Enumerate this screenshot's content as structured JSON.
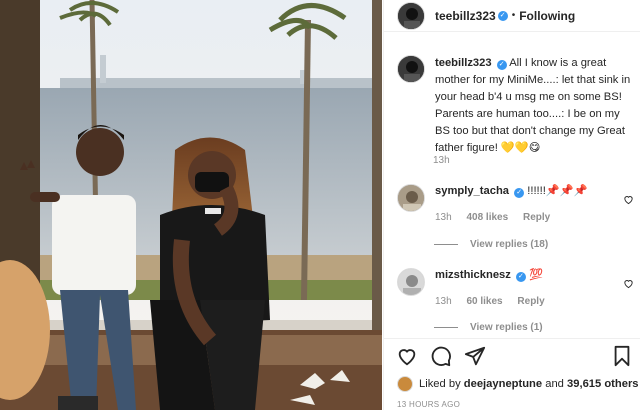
{
  "post": {
    "username": "teebillz323",
    "follow_status": "Following",
    "separator": "•",
    "verified_mark": "✓",
    "caption_username": "teebillz323",
    "caption_text": "All I know is a great mother for my MiniMe....: let that sink in your head b'4 u msg me on some BS! Parents are human too....: I be on my BS too but that don't change my Great father figure! 💛💛😋",
    "caption_time": "13h"
  },
  "comments": [
    {
      "username": "symply_tacha",
      "text": "!!!!!!📌📌📌",
      "time": "13h",
      "likes": "408 likes",
      "reply_label": "Reply",
      "view_replies": "View replies (18)",
      "avatar_color": "#9a8f7e"
    },
    {
      "username": "mizsthicknesz",
      "text": "💯",
      "time": "13h",
      "likes": "60 likes",
      "reply_label": "Reply",
      "view_replies": "View replies (1)",
      "avatar_color": "#c8c8c8"
    }
  ],
  "footer": {
    "liked_by_prefix": "Liked by",
    "liked_by_user": "deejayneptune",
    "liked_by_and": "and",
    "liked_by_count": "39,615 others",
    "timestamp": "13 HOURS AGO"
  },
  "icons": {
    "heart": "heart-icon",
    "comment": "comment-icon",
    "share": "share-icon",
    "bookmark": "bookmark-icon"
  },
  "colors": {
    "verified": "#3897f0",
    "text": "#262626",
    "muted": "#8e8e8e",
    "border": "#efefef"
  }
}
